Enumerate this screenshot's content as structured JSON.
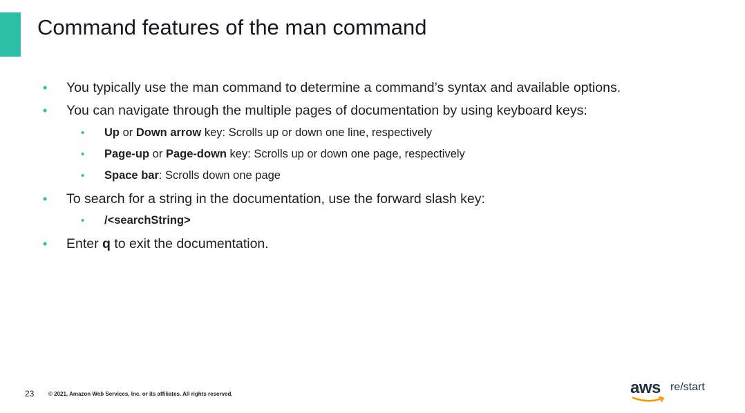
{
  "slide": {
    "title": "Command features of the man command",
    "bullets": {
      "b1": {
        "text": "You typically use the man command to determine a command’s syntax and available options."
      },
      "b2": {
        "text": "You can navigate through the multiple pages of documentation by using keyboard keys:"
      },
      "b2_1": {
        "k1": "Up",
        "mid": " or ",
        "k2": "Down arrow",
        "rest": " key: Scrolls up or down one line, respectively"
      },
      "b2_2": {
        "k1": "Page-up",
        "mid": " or ",
        "k2": "Page-down",
        "rest": " key: Scrolls up or down one page, respectively"
      },
      "b2_3": {
        "k1": "Space bar",
        "rest": ": Scrolls down one page"
      },
      "b3": {
        "text": "To search for a string in the documentation, use the forward slash key:"
      },
      "b3_1": {
        "k1": "/<searchString>"
      },
      "b4": {
        "pre": "Enter ",
        "key": "q",
        "post": " to exit the documentation."
      }
    },
    "bullet_char": "•"
  },
  "footer": {
    "page_number": "23",
    "copyright": "© 2021, Amazon Web Services, Inc. or its affiliates. All rights reserved."
  },
  "logo": {
    "aws": "aws",
    "restart": "re/start"
  },
  "colors": {
    "accent": "#2bbfa7",
    "text": "#1f1f1f",
    "logo_dark": "#232f3e",
    "logo_orange": "#ff9900"
  }
}
